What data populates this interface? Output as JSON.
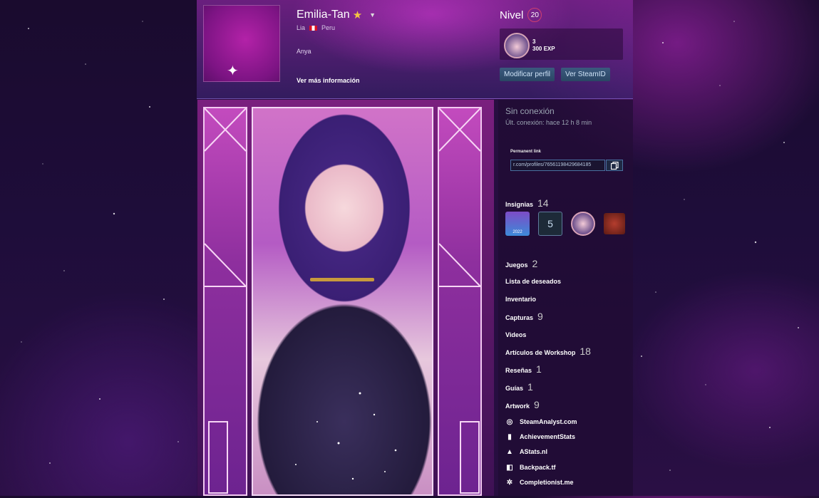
{
  "profile": {
    "persona_name": "Emilia-Tan",
    "real_name": "Lia",
    "country": "Peru",
    "summary": "Anya",
    "more_info": "Ver más información"
  },
  "level": {
    "label": "Nivel",
    "value": "20",
    "badge_number": "3",
    "exp": "300 EXP"
  },
  "buttons": {
    "edit_profile": "Modificar perfil",
    "steam_id": "Ver SteamID"
  },
  "status": {
    "state": "Sin conexión",
    "last_online": "Últ. conexión: hace 12 h 8 min"
  },
  "permalink": {
    "label": "Permanent link",
    "value": "r.com/profiles/76561198429684185"
  },
  "badges": {
    "label": "Insignias",
    "count": "14",
    "items": [
      {
        "icon": "steam-2022-badge-icon",
        "text": "2022"
      },
      {
        "icon": "years-service-badge-icon",
        "text": "5"
      },
      {
        "icon": "community-badge-icon"
      },
      {
        "icon": "game-badge-icon"
      }
    ]
  },
  "sections": [
    {
      "label": "Juegos",
      "count": "2"
    },
    {
      "label": "Lista de deseados",
      "count": ""
    },
    {
      "label": "Inventario",
      "count": ""
    },
    {
      "label": "Capturas",
      "count": "9"
    },
    {
      "label": "Videos",
      "count": ""
    },
    {
      "label": "Artículos de Workshop",
      "count": "18"
    },
    {
      "label": "Reseñas",
      "count": "1"
    },
    {
      "label": "Guías",
      "count": "1"
    },
    {
      "label": "Artwork",
      "count": "9"
    }
  ],
  "external_links": [
    {
      "label": "SteamAnalyst.com",
      "icon": "steamanalyst-icon"
    },
    {
      "label": "AchievementStats",
      "icon": "bar-chart-icon"
    },
    {
      "label": "AStats.nl",
      "icon": "astats-icon"
    },
    {
      "label": "Backpack.tf",
      "icon": "backpack-icon"
    },
    {
      "label": "Completionist.me",
      "icon": "completionist-icon"
    }
  ],
  "colors": {
    "accent": "#c72fc0",
    "button": "#2f4e70",
    "level_ring": "#cf3f6f"
  }
}
